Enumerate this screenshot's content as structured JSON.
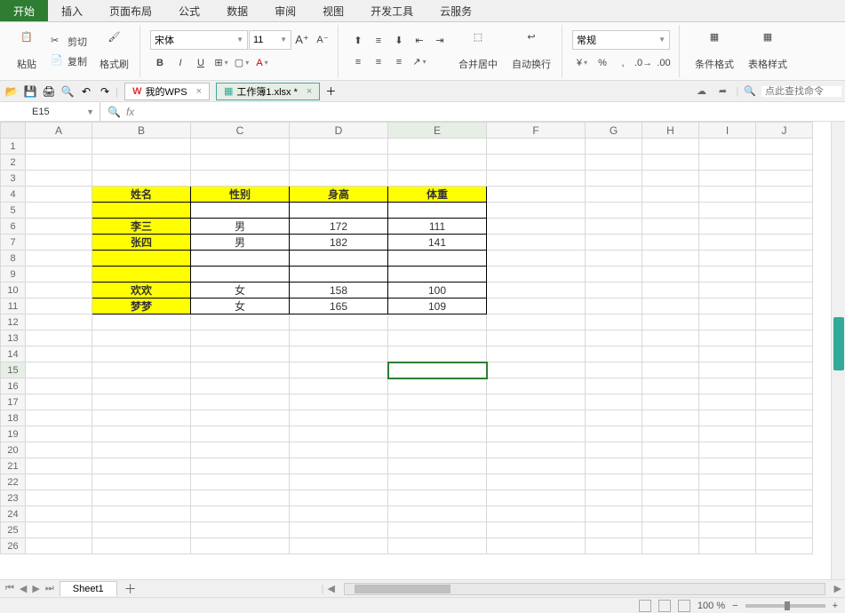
{
  "tabs": [
    "开始",
    "插入",
    "页面布局",
    "公式",
    "数据",
    "审阅",
    "视图",
    "开发工具",
    "云服务"
  ],
  "ribbon": {
    "paste": "粘贴",
    "cut": "剪切",
    "copy": "复制",
    "format_painter": "格式刷",
    "font_name": "宋体",
    "font_size": "11",
    "merge_center": "合并居中",
    "wrap_text": "自动换行",
    "number_format": "常规",
    "cond_format": "条件格式",
    "table_style": "表格样式"
  },
  "doc_tabs": {
    "wps": "我的WPS",
    "book": "工作簿1.xlsx *"
  },
  "search_placeholder": "点此查找命令",
  "name_box": "E15",
  "cols": [
    "A",
    "B",
    "C",
    "D",
    "E",
    "F",
    "G",
    "H",
    "I",
    "J"
  ],
  "row_count": 26,
  "table": {
    "headers": {
      "r": 4,
      "B": "姓名",
      "C": "性别",
      "D": "身高",
      "E": "体重"
    },
    "rows": [
      {
        "r": 6,
        "B": "李三",
        "C": "男",
        "D": "172",
        "E": "111"
      },
      {
        "r": 7,
        "B": "张四",
        "C": "男",
        "D": "182",
        "E": "141"
      },
      {
        "r": 10,
        "B": "欢欢",
        "C": "女",
        "D": "158",
        "E": "100"
      },
      {
        "r": 11,
        "B": "梦梦",
        "C": "女",
        "D": "165",
        "E": "109"
      }
    ],
    "yellow_rows": [
      4,
      5,
      6,
      7,
      8,
      9,
      10,
      11
    ],
    "border_rows": [
      4,
      5,
      6,
      7,
      8,
      9,
      10,
      11
    ]
  },
  "sheet_name": "Sheet1",
  "zoom": "100 %",
  "selected": {
    "row": 15,
    "col": "E"
  }
}
